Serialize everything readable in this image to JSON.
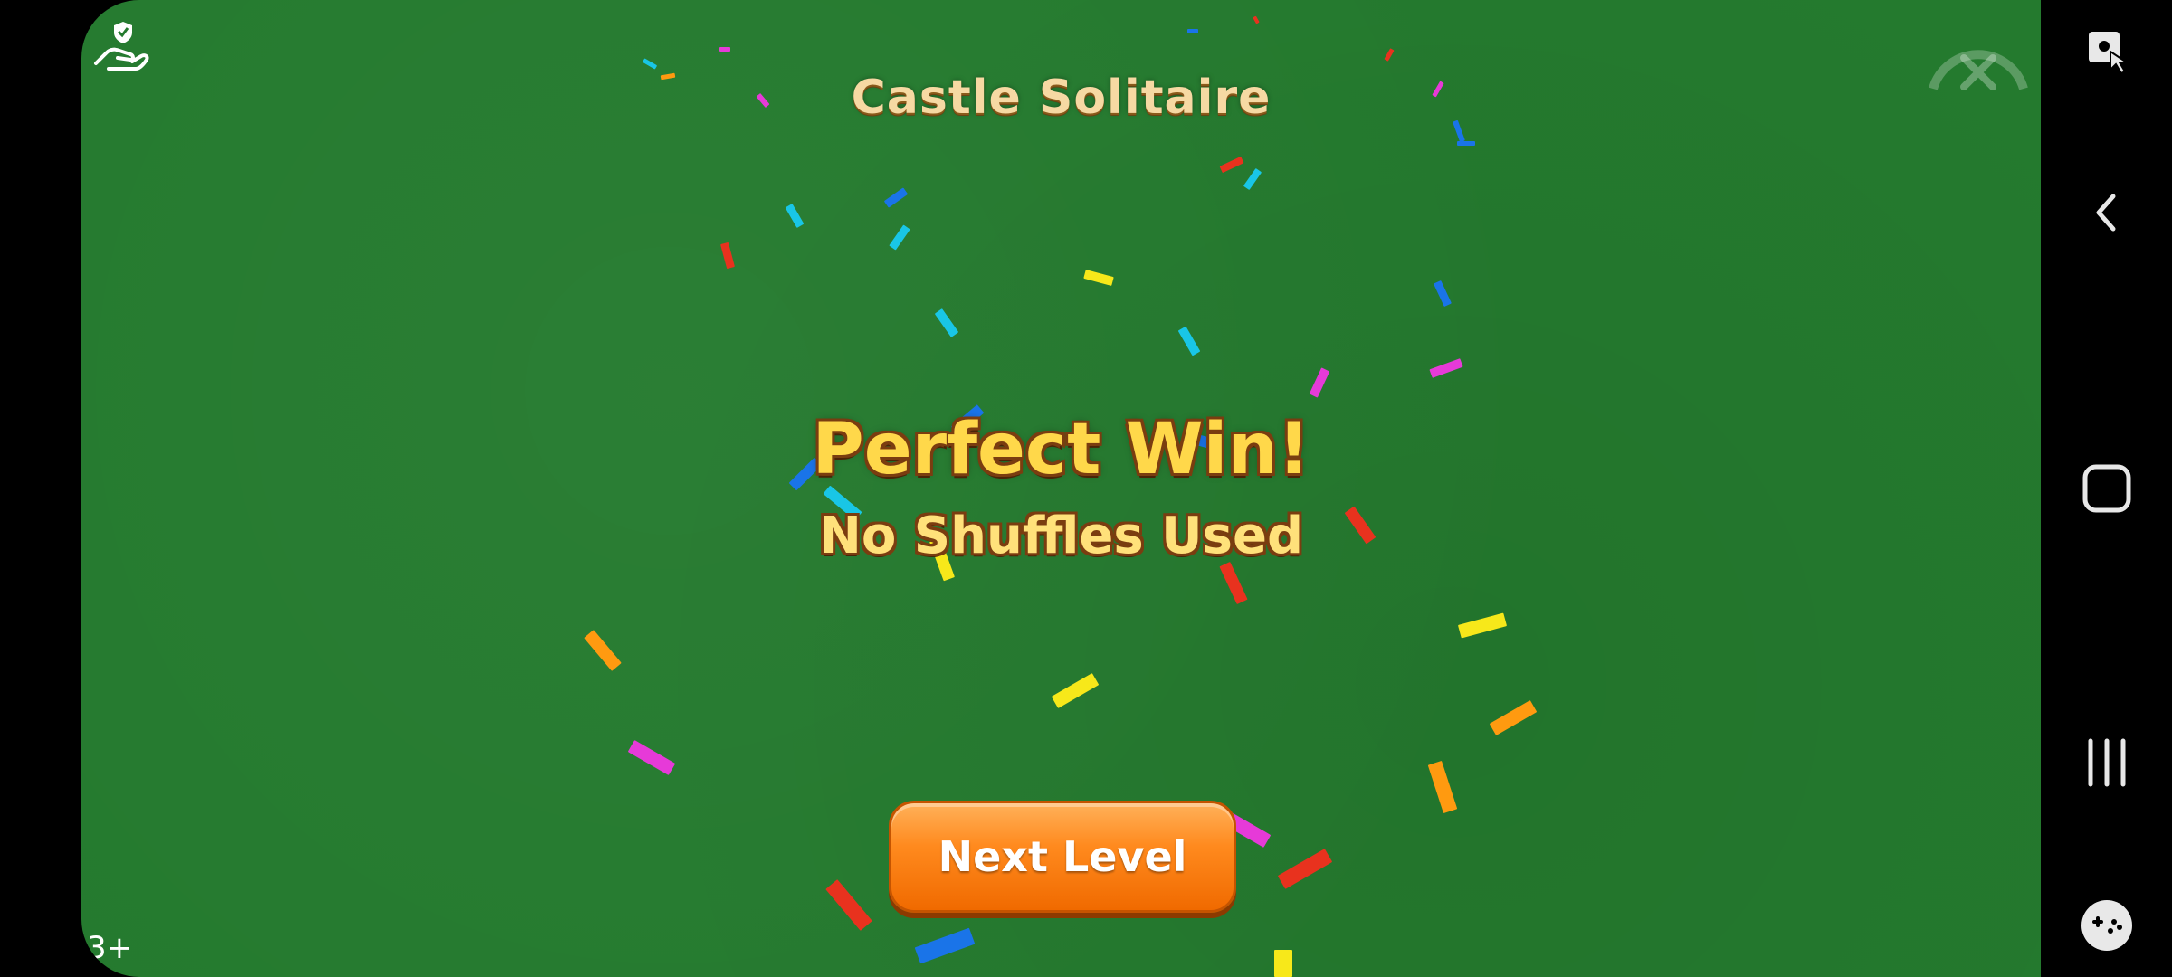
{
  "game": {
    "title": "Castle Solitaire",
    "headline": "Perfect Win!",
    "subheadline": "No Shuffles Used",
    "next_button_label": "Next Level",
    "age_rating": "3+",
    "accent_colors": {
      "felt": "#247a2e",
      "gold_text": "#ffd84a",
      "button_orange": "#ff8a1e"
    },
    "icons": {
      "top_left": "hand-shield-icon",
      "close": "close-icon"
    }
  },
  "navbar": {
    "items": [
      "screen-pin-icon",
      "back-icon",
      "home-icon",
      "recents-icon",
      "game-tools-icon"
    ]
  }
}
